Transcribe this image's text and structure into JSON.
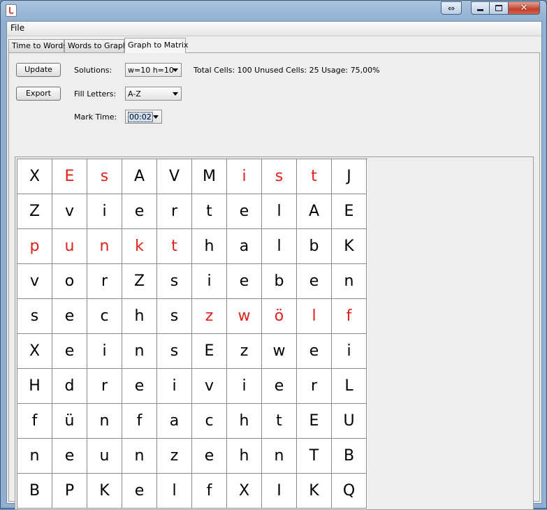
{
  "menu": {
    "file": "File"
  },
  "tabs": [
    {
      "label": "Time to Words"
    },
    {
      "label": "Words to Graph"
    },
    {
      "label": "Graph to Matrix"
    }
  ],
  "controls": {
    "update_label": "Update",
    "export_label": "Export",
    "solutions_label": "Solutions:",
    "solutions_value": "w=10 h=10",
    "fill_label": "Fill Letters:",
    "fill_value": "A-Z",
    "mark_label": "Mark Time:",
    "mark_value": "00:02",
    "stats": "Total Cells: 100 Unused Cells: 25 Usage: 75,00%"
  },
  "colors": {
    "highlight": "#e0201b",
    "normal": "#000000"
  },
  "matrix": {
    "rows": [
      [
        "X",
        "E",
        "s",
        "A",
        "V",
        "M",
        "i",
        "s",
        "t",
        "J"
      ],
      [
        "Z",
        "v",
        "i",
        "e",
        "r",
        "t",
        "e",
        "l",
        "A",
        "E"
      ],
      [
        "p",
        "u",
        "n",
        "k",
        "t",
        "h",
        "a",
        "l",
        "b",
        "K"
      ],
      [
        "v",
        "o",
        "r",
        "Z",
        "s",
        "i",
        "e",
        "b",
        "e",
        "n"
      ],
      [
        "s",
        "e",
        "c",
        "h",
        "s",
        "z",
        "w",
        "ö",
        "l",
        "f"
      ],
      [
        "X",
        "e",
        "i",
        "n",
        "s",
        "E",
        "z",
        "w",
        "e",
        "i"
      ],
      [
        "H",
        "d",
        "r",
        "e",
        "i",
        "v",
        "i",
        "e",
        "r",
        "L"
      ],
      [
        "f",
        "ü",
        "n",
        "f",
        "a",
        "c",
        "h",
        "t",
        "E",
        "U"
      ],
      [
        "n",
        "e",
        "u",
        "n",
        "z",
        "e",
        "h",
        "n",
        "T",
        "B"
      ],
      [
        "B",
        "P",
        "K",
        "e",
        "l",
        "f",
        "X",
        "I",
        "K",
        "Q"
      ]
    ],
    "highlighted": [
      [
        0,
        1
      ],
      [
        0,
        2
      ],
      [
        0,
        6
      ],
      [
        0,
        7
      ],
      [
        0,
        8
      ],
      [
        2,
        0
      ],
      [
        2,
        1
      ],
      [
        2,
        2
      ],
      [
        2,
        3
      ],
      [
        2,
        4
      ],
      [
        4,
        5
      ],
      [
        4,
        6
      ],
      [
        4,
        7
      ],
      [
        4,
        8
      ],
      [
        4,
        9
      ]
    ]
  }
}
